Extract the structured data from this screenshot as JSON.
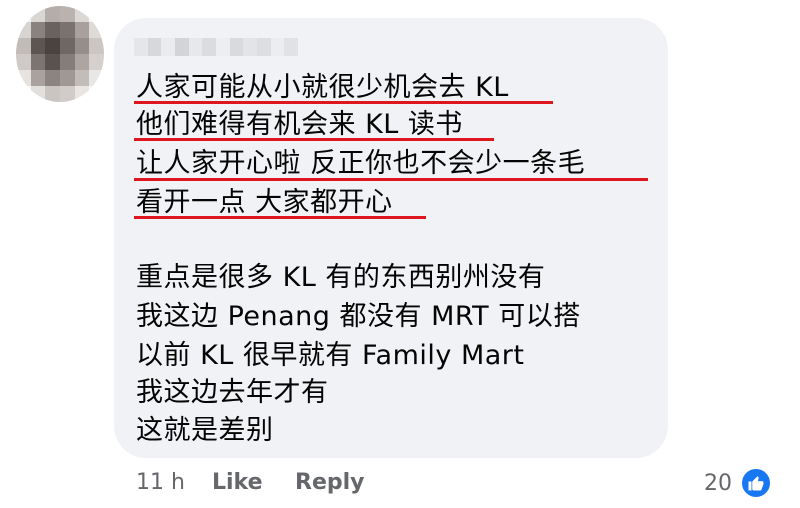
{
  "comment": {
    "author_name": "",
    "lines": [
      "人家可能从小就很少机会去 KL",
      "他们难得有机会来 KL 读书",
      "让人家开心啦 反正你也不会少一条毛",
      "看开一点 大家都开心",
      "重点是很多 KL 有的东西别州没有",
      "我这边 Penang 都没有 MRT 可以搭",
      "以前 KL 很早就有 Family Mart",
      "我这边去年才有",
      "这就是差别"
    ],
    "underline_color": "#e0161e"
  },
  "footer": {
    "timestamp": "11 h",
    "like_label": "Like",
    "reply_label": "Reply",
    "reaction_count": "20",
    "reaction_icon": "thumbs-up-icon",
    "reaction_color": "#1877f2"
  },
  "avatar": {
    "icon": "avatar-pixelated"
  }
}
